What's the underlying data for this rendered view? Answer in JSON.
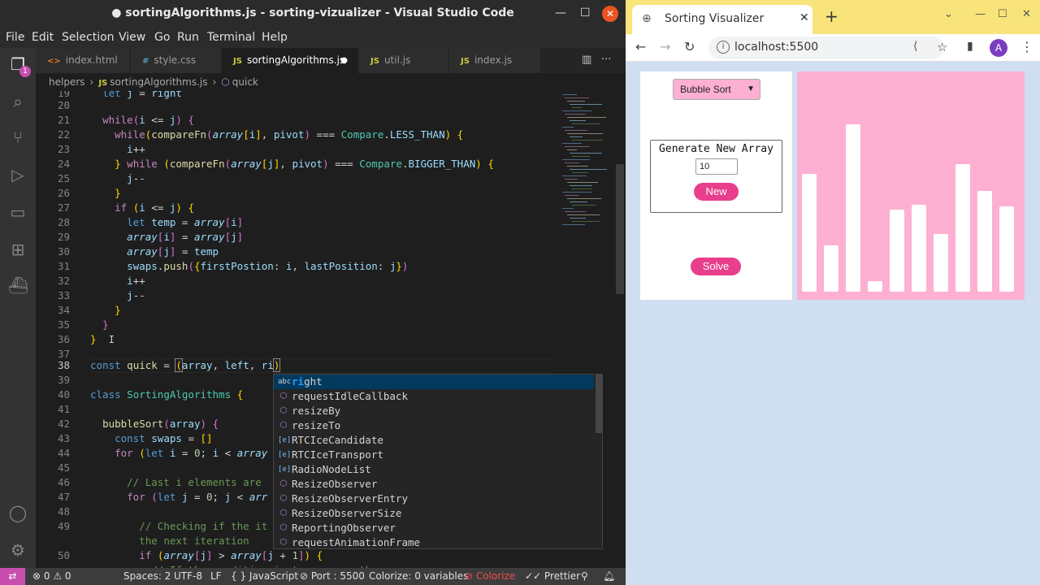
{
  "vscode": {
    "window_title": "● sortingAlgorithms.js - sorting-vizualizer - Visual Studio Code",
    "menu": [
      "File",
      "Edit",
      "Selection",
      "View",
      "Go",
      "Run",
      "Terminal",
      "Help"
    ],
    "scm_badge": "1",
    "tabs": [
      {
        "icon": "<>",
        "label": "index.html"
      },
      {
        "icon": "#",
        "label": "style.css"
      },
      {
        "icon": "JS",
        "label": "sortingAlgorithms.js",
        "modified": "●"
      },
      {
        "icon": "JS",
        "label": "util.js"
      },
      {
        "icon": "JS",
        "label": "index.js"
      }
    ],
    "breadcrumb": [
      "helpers",
      "sortingAlgorithms.js",
      "quick"
    ],
    "line_numbers": [
      "19",
      "20",
      "21",
      "22",
      "23",
      "24",
      "25",
      "26",
      "27",
      "28",
      "29",
      "30",
      "31",
      "32",
      "33",
      "34",
      "35",
      "36",
      "37",
      "38",
      "39",
      "40",
      "41",
      "42",
      "43",
      "44",
      "45",
      "46",
      "47",
      "48",
      "49",
      "",
      "50"
    ],
    "suggestions": [
      {
        "kind": "abc",
        "match": "ri",
        "rest": "ght"
      },
      {
        "kind": "method",
        "label": "requestIdleCallback"
      },
      {
        "kind": "method",
        "label": "resizeBy"
      },
      {
        "kind": "method",
        "label": "resizeTo"
      },
      {
        "kind": "interface",
        "label": "RTCIceCandidate"
      },
      {
        "kind": "interface",
        "label": "RTCIceTransport"
      },
      {
        "kind": "interface",
        "label": "RadioNodeList"
      },
      {
        "kind": "method",
        "label": "ResizeObserver"
      },
      {
        "kind": "method",
        "label": "ResizeObserverEntry"
      },
      {
        "kind": "method",
        "label": "ResizeObserverSize"
      },
      {
        "kind": "method",
        "label": "ReportingObserver"
      },
      {
        "kind": "method",
        "label": "requestAnimationFrame"
      }
    ],
    "status": {
      "errors": "⊗ 0 ⚠ 0",
      "spaces": "Spaces: 2",
      "encoding": "UTF-8",
      "eol": "LF",
      "language": "{ } JavaScript",
      "port": "⊘ Port : 5500",
      "colorize_vars": "Colorize: 0 variables",
      "colorize": "⊘ Colorize",
      "prettier": "✓✓ Prettier"
    }
  },
  "browser": {
    "tab_title": "Sorting Visualizer",
    "url": "localhost:5500",
    "avatar": "A",
    "algorithm": "Bubble Sort",
    "generate_title": "Generate New Array",
    "size_value": "10",
    "new_label": "New",
    "solve_label": "Solve",
    "bars": [
      0.69,
      0.27,
      0.98,
      0.06,
      0.48,
      0.51,
      0.34,
      0.75,
      0.59,
      0.5
    ]
  },
  "colors": {
    "accent_pink": "#e83e8c",
    "panel_pink": "#fdb0d2",
    "status_remote": "#c74ead",
    "chrome_tabstrip": "#f8e47a"
  }
}
